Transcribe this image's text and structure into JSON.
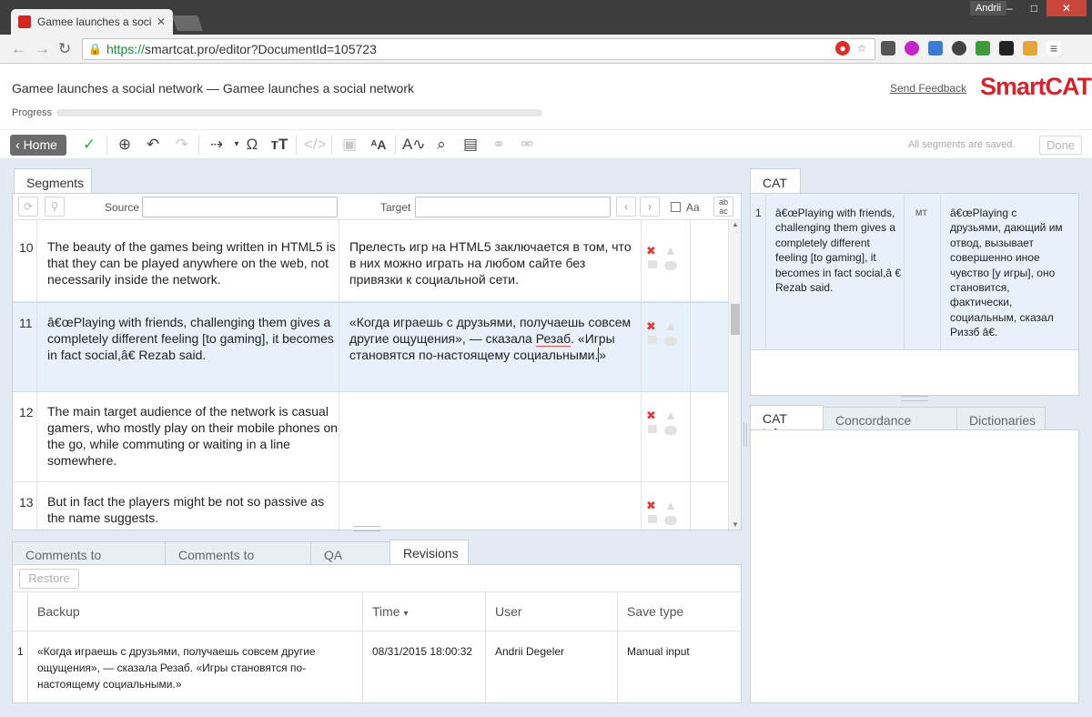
{
  "browser": {
    "tab_title": "Gamee launches a social r",
    "user": "Andrii",
    "url_scheme": "https://",
    "url_rest": "smartcat.pro/editor?DocumentId=105723"
  },
  "header": {
    "doc_title": "Gamee launches a social network — Gamee launches a social network",
    "progress_label": "Progress",
    "progress_value": 0,
    "feedback": "Send Feedback",
    "logo": "SmartCAT"
  },
  "toolbar": {
    "home": "Home",
    "saved_status": "All segments are saved.",
    "done": "Done"
  },
  "segments": {
    "tab": "Segments",
    "source_label": "Source",
    "target_label": "Target",
    "case_label": "Aa",
    "rows": [
      {
        "num": "10",
        "source": "The beauty of the games being written in HTML5 is that they can be played anywhere on the web, not necessarily inside the network.",
        "target": "Прелесть игр на HTML5 заключается в том, что в них можно играть на любом сайте без привязки к социальной сети."
      },
      {
        "num": "11",
        "source": "â€œPlaying with friends, challenging them gives a completely different feeling [to gaming], it becomes in fact social,â€ Rezab said.",
        "target_a": "«Когда играешь с друзьями, получаешь совсем другие ощущения», — сказала ",
        "target_b": "Резаб",
        "target_c": ". «Игры становятся по-настоящему социальными.",
        "target_d": "»"
      },
      {
        "num": "12",
        "source": "The main target audience of the network is casual gamers, who mostly play on their mobile phones on the go, while commuting or waiting in a line somewhere.",
        "target": ""
      },
      {
        "num": "13",
        "source": "But in fact the players might be not so passive as the name suggests.",
        "target": ""
      }
    ]
  },
  "bottom": {
    "tabs": [
      "Comments to Document",
      "Comments to Segment",
      "QA Check",
      "Revisions"
    ],
    "restore": "Restore",
    "columns": [
      "Backup",
      "Time",
      "User",
      "Save type"
    ],
    "sort_arrow": "▾",
    "row": {
      "num": "1",
      "backup": "«Когда играешь с друзьями, получаешь совсем другие ощущения», — сказала Резаб. «Игры становятся по-настоящему социальными.»",
      "time": "08/31/2015 18:00:32",
      "user": "Andrii Degeler",
      "save_type": "Manual input"
    }
  },
  "cat": {
    "tab": "CAT",
    "num": "1",
    "source": "â€œPlaying with friends, challenging them gives a completely different feeling [to gaming], it becomes in fact social,â € Rezab said.",
    "badge": "MT",
    "target": "â€œPlaying с друзьями, дающий им отвод, вызывает совершенно иное чувство [у игры], оно становится, фактически, социальным, сказал Риззб â€."
  },
  "info_tabs": [
    "CAT Info",
    "Concordance Search",
    "Dictionaries"
  ],
  "colors": {
    "accent": "#d0262d",
    "active_row": "#e7f1fb",
    "panel_bg": "#e3eaf1"
  }
}
